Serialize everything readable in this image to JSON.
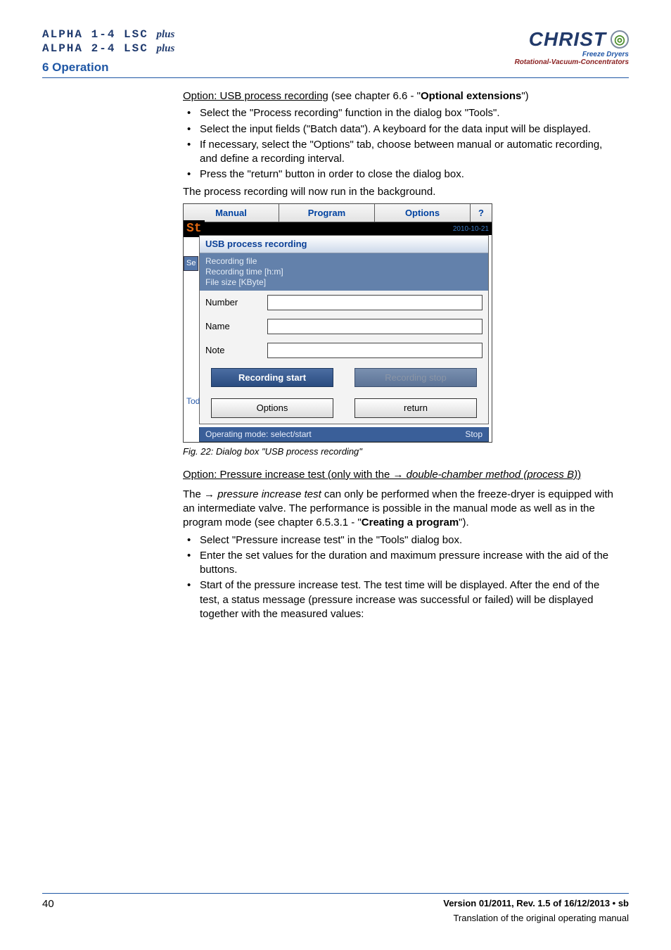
{
  "brand": {
    "line1_main": "ALPHA 1-4 LSC",
    "line2_main": "ALPHA 2-4 LSC",
    "plus": "plus"
  },
  "section_title": "6 Operation",
  "logo": {
    "name": "CHRIST",
    "sub1": "Freeze Dryers",
    "sub2": "Rotational-Vacuum-Concentrators"
  },
  "usb_option": {
    "heading_prefix": "Option: USB process recording",
    "heading_suffix": " (see chapter 6.6 - \"",
    "heading_bold": "Optional extensions",
    "heading_end": "\")",
    "bullets": [
      "Select the \"Process recording\" function in the dialog box \"Tools\".",
      "Select the input fields (\"Batch data\"). A keyboard for the data input will be displayed.",
      "If necessary, select the \"Options\" tab, choose between manual or automatic recording, and define a recording interval.",
      "Press the \"return\" button in order to close the dialog box."
    ],
    "post_line": "The process recording will now run in the background."
  },
  "dialog": {
    "tabs": {
      "manual": "Manual",
      "program": "Program",
      "options": "Options",
      "help": "?"
    },
    "standby_label": "St",
    "se_label": "Se",
    "tod_label": "Tod",
    "date": "2010-10-21",
    "title": "USB process recording",
    "rec_info": {
      "l1": "Recording file",
      "l2": "Recording time [h:m]",
      "l3": "File size [KByte]"
    },
    "fields": {
      "number": "Number",
      "name": "Name",
      "note": "Note"
    },
    "buttons": {
      "start": "Recording start",
      "stop": "Recording stop",
      "options": "Options",
      "ret": "return"
    },
    "status_left": "Operating mode: select/start",
    "status_right": "Stop"
  },
  "fig_caption": "Fig. 22: Dialog box \"USB process recording\"",
  "pressure_option": {
    "prefix": "Option: Pressure increase test (only with the → ",
    "italic": "double-chamber method (process B)",
    "suffix": ")",
    "para_pre": "The → ",
    "para_italic": "pressure increase test",
    "para_post": " can only be performed when the freeze-dryer is equipped with an intermediate valve. The performance is possible in the manual mode as well as in the program mode (see chapter 6.5.3.1 - \"",
    "para_bold": "Creating a program",
    "para_end": "\").",
    "bullets": [
      "Select \"Pressure increase test\" in the \"Tools\" dialog box.",
      "Enter the set values for the duration and maximum pressure increase with the aid of the buttons.",
      "Start of the pressure increase test. The test time will be displayed. After the end of the test, a status message (pressure increase was successful or failed) will be displayed together with the measured values:"
    ]
  },
  "footer": {
    "page": "40",
    "version": "Version 01/2011, Rev. 1.5 of 16/12/2013 • sb",
    "translation": "Translation of the original operating manual"
  }
}
